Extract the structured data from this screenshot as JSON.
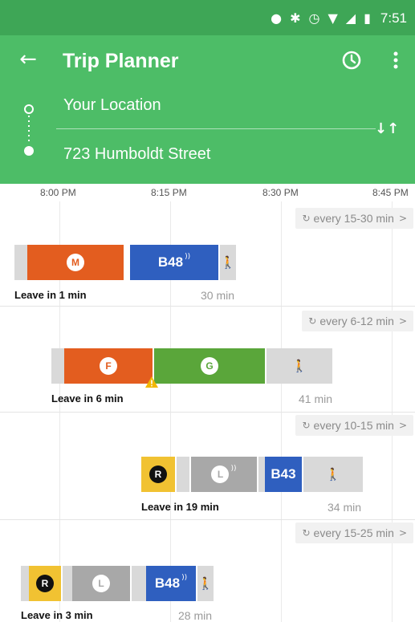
{
  "status": {
    "time": "7:51",
    "icons": [
      "location-icon",
      "bluetooth-icon",
      "alarm-icon",
      "wifi-icon",
      "signal-icon",
      "battery-icon"
    ]
  },
  "appbar": {
    "title": "Trip Planner",
    "icons": [
      "back-arrow-icon",
      "clock-icon",
      "more-vert-icon"
    ]
  },
  "route": {
    "origin": "Your Location",
    "destination": "723 Humboldt Street",
    "swap_icon": "swap-icon"
  },
  "timeline": {
    "ticks": [
      "8:00 PM",
      "8:15 PM",
      "8:30 PM",
      "8:45 PM"
    ]
  },
  "trips": [
    {
      "frequency": "every 15-30 min",
      "leave": "Leave in 1 min",
      "duration": "30 min",
      "segments": [
        {
          "kind": "wait"
        },
        {
          "kind": "transit",
          "badge": "M",
          "color": "#e35d1f"
        },
        {
          "kind": "bus",
          "label": "B48",
          "color": "#2f5fbf",
          "realtime": true
        },
        {
          "kind": "walk"
        }
      ]
    },
    {
      "frequency": "every 6-12 min",
      "leave": "Leave in 6 min",
      "duration": "41 min",
      "alert": true,
      "segments": [
        {
          "kind": "wait"
        },
        {
          "kind": "transit",
          "badge": "F",
          "color": "#e35d1f"
        },
        {
          "kind": "transit",
          "badge": "G",
          "color": "#5aa63a"
        },
        {
          "kind": "walk"
        }
      ]
    },
    {
      "frequency": "every 10-15 min",
      "leave": "Leave in 19 min",
      "duration": "34 min",
      "segments": [
        {
          "kind": "transit",
          "badge": "R",
          "color": "#f1c232"
        },
        {
          "kind": "wait"
        },
        {
          "kind": "transit",
          "badge": "L",
          "color": "#a8a8a8",
          "realtime": true
        },
        {
          "kind": "wait"
        },
        {
          "kind": "bus",
          "label": "B43",
          "color": "#2f5fbf"
        },
        {
          "kind": "walk"
        }
      ]
    },
    {
      "frequency": "every 15-25 min",
      "leave": "Leave in 3 min",
      "duration": "28 min",
      "segments": [
        {
          "kind": "wait"
        },
        {
          "kind": "transit",
          "badge": "R",
          "color": "#f1c232"
        },
        {
          "kind": "wait"
        },
        {
          "kind": "transit",
          "badge": "L",
          "color": "#a8a8a8"
        },
        {
          "kind": "wait"
        },
        {
          "kind": "bus",
          "label": "B48",
          "color": "#2f5fbf",
          "realtime": true
        },
        {
          "kind": "walk"
        }
      ]
    }
  ]
}
